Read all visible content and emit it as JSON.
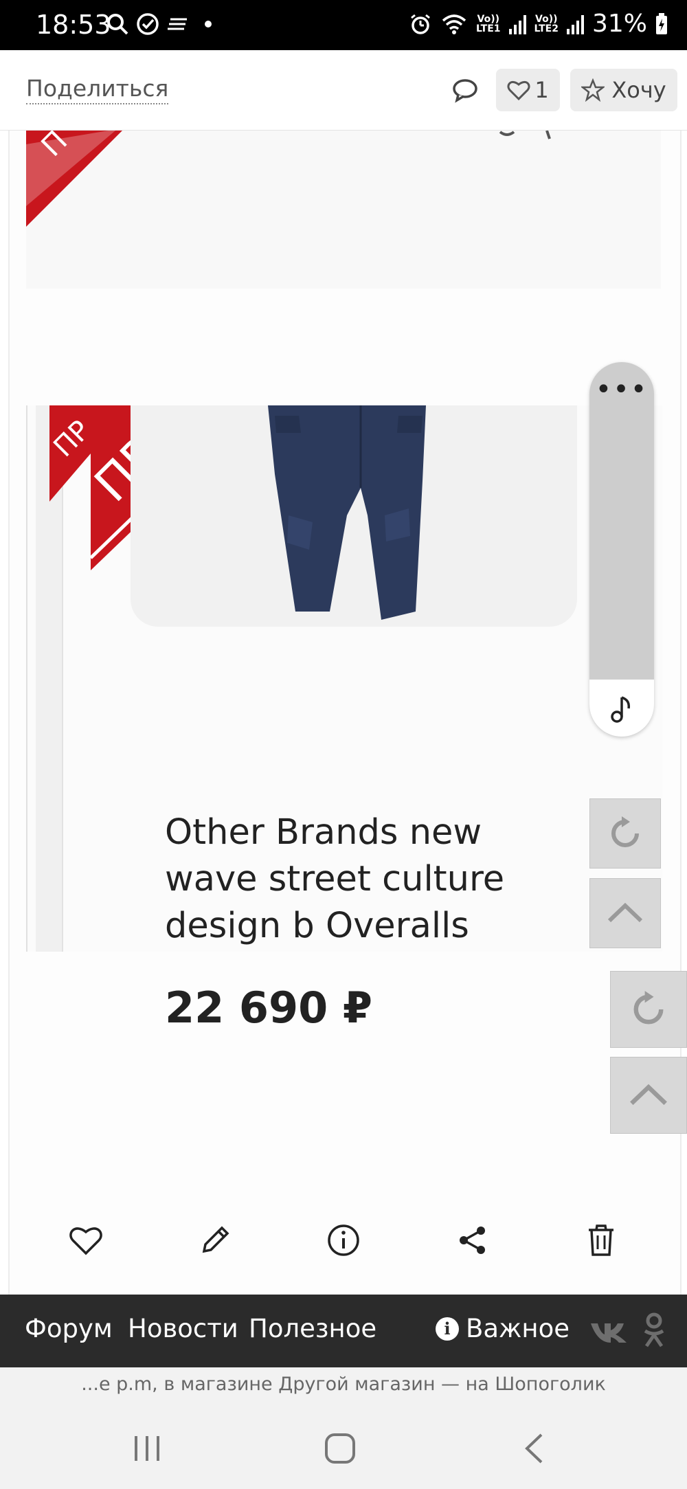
{
  "status_bar": {
    "time": "18:53",
    "battery": "31%",
    "lte1_label": "Vo)) LTE1",
    "lte2_label": "Vo)) LTE2"
  },
  "app_bar": {
    "share_label": "Поделиться",
    "like_count": "1",
    "want_label": "Хочу"
  },
  "product": {
    "title": "Other Brands new wave street culture design b Overalls",
    "price": "22 690 ₽",
    "ribbon_text": "ПРО"
  },
  "bottom_nav": {
    "forum": "Форум",
    "news": "Новости",
    "useful": "Полезное",
    "important": "Важное"
  },
  "caption": "...е p.m, в магазине Другой магазин — на Шопоголик",
  "colors": {
    "ribbon_red": "#c8161d",
    "nav_dark": "#2b2b2b",
    "pants_navy": "#2c3a5c"
  }
}
